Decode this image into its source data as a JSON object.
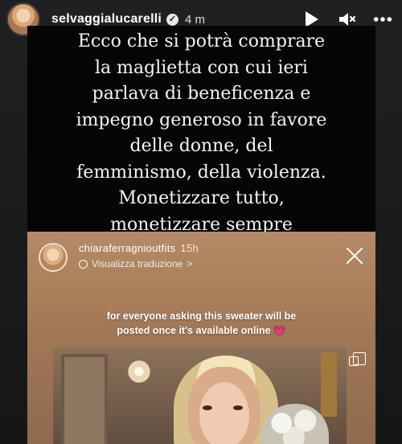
{
  "header": {
    "username": "selvaggialucarelli",
    "time": "4 m",
    "icons": {
      "verified": "verified-badge-icon",
      "play": "play-icon",
      "mute": "mute-icon",
      "more": "more-icon"
    }
  },
  "caption": {
    "lines": [
      "Ecco  che si potrà  comprare",
      "la maglietta con cui ieri",
      "parlava di beneficenza e",
      "impegno generoso in favore",
      "delle donne, del",
      "femminismo, della violenza.",
      "Monetizzare tutto,",
      "monetizzare sempre"
    ]
  },
  "repost": {
    "username": "chiaraferragnioutfits",
    "time": "15h",
    "translate_label": "Visualizza traduzione",
    "translate_chevron": ">",
    "sticker_line1": "for everyone asking this sweater will be",
    "sticker_line2": "posted once it's available online",
    "heart": "💗",
    "icons": {
      "translate": "globe-icon",
      "close": "close-icon",
      "copy": "copy-icon"
    }
  },
  "colors": {
    "story_bg": "#1c1c1c",
    "caption_bg": "#050505",
    "repost_bg": "#a47a58",
    "heart": "#e16bd1"
  }
}
